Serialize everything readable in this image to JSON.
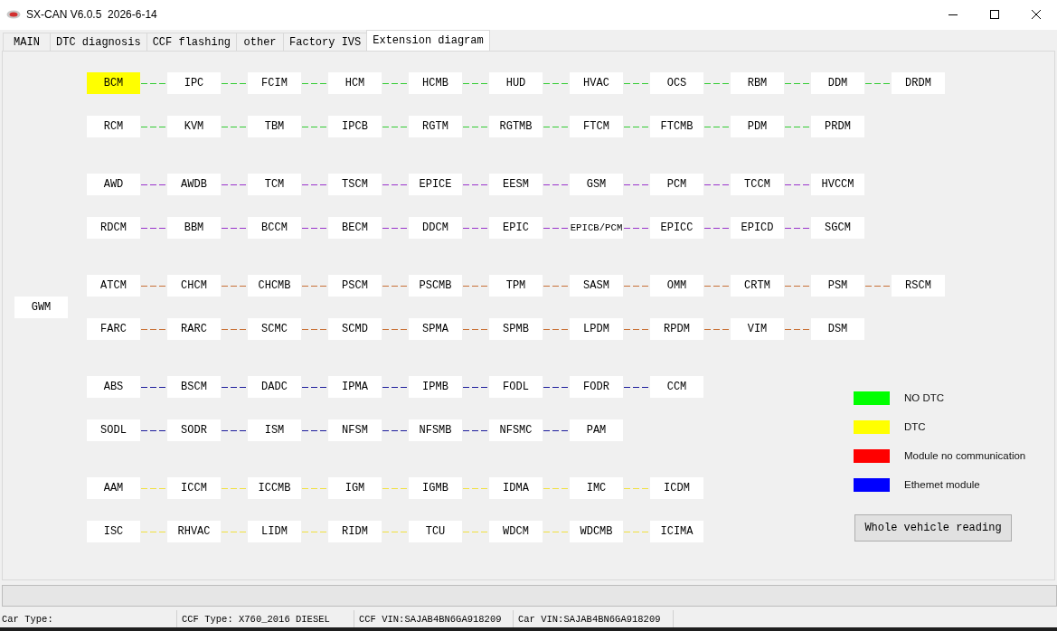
{
  "window": {
    "title": "SX-CAN V6.0.5  2026-6-14"
  },
  "tabs": [
    {
      "label": "MAIN",
      "selected": false
    },
    {
      "label": "DTC diagnosis",
      "selected": false
    },
    {
      "label": "CCF flashing",
      "selected": false
    },
    {
      "label": "other",
      "selected": false
    },
    {
      "label": "Factory IVS",
      "selected": false
    },
    {
      "label": "Extension diagram",
      "selected": true
    }
  ],
  "gateway": {
    "label": "GWM",
    "dtc": false
  },
  "groups": [
    {
      "color": "#33cc33",
      "rows": [
        [
          {
            "label": "BCM",
            "dtc": true
          },
          {
            "label": "IPC",
            "dtc": false
          },
          {
            "label": "FCIM",
            "dtc": false
          },
          {
            "label": "HCM",
            "dtc": false
          },
          {
            "label": "HCMB",
            "dtc": false
          },
          {
            "label": "HUD",
            "dtc": false
          },
          {
            "label": "HVAC",
            "dtc": false
          },
          {
            "label": "OCS",
            "dtc": false
          },
          {
            "label": "RBM",
            "dtc": false
          },
          {
            "label": "DDM",
            "dtc": false
          },
          {
            "label": "DRDM",
            "dtc": false
          }
        ],
        [
          {
            "label": "RCM",
            "dtc": false
          },
          {
            "label": "KVM",
            "dtc": false
          },
          {
            "label": "TBM",
            "dtc": false
          },
          {
            "label": "IPCB",
            "dtc": false
          },
          {
            "label": "RGTM",
            "dtc": false
          },
          {
            "label": "RGTMB",
            "dtc": false
          },
          {
            "label": "FTCM",
            "dtc": false
          },
          {
            "label": "FTCMB",
            "dtc": false
          },
          {
            "label": "PDM",
            "dtc": false
          },
          {
            "label": "PRDM",
            "dtc": false
          }
        ]
      ]
    },
    {
      "color": "#9933cc",
      "rows": [
        [
          {
            "label": "AWD",
            "dtc": false
          },
          {
            "label": "AWDB",
            "dtc": false
          },
          {
            "label": "TCM",
            "dtc": false
          },
          {
            "label": "TSCM",
            "dtc": false
          },
          {
            "label": "EPICE",
            "dtc": false
          },
          {
            "label": "EESM",
            "dtc": false
          },
          {
            "label": "GSM",
            "dtc": false
          },
          {
            "label": "PCM",
            "dtc": false
          },
          {
            "label": "TCCM",
            "dtc": false
          },
          {
            "label": "HVCCM",
            "dtc": false
          }
        ],
        [
          {
            "label": "RDCM",
            "dtc": false
          },
          {
            "label": "BBM",
            "dtc": false
          },
          {
            "label": "BCCM",
            "dtc": false
          },
          {
            "label": "BECM",
            "dtc": false
          },
          {
            "label": "DDCM",
            "dtc": false
          },
          {
            "label": "EPIC",
            "dtc": false
          },
          {
            "label": "EPICB/PCM",
            "dtc": false
          },
          {
            "label": "EPICC",
            "dtc": false
          },
          {
            "label": "EPICD",
            "dtc": false
          },
          {
            "label": "SGCM",
            "dtc": false
          }
        ]
      ]
    },
    {
      "color": "#c87137",
      "rows": [
        [
          {
            "label": "ATCM",
            "dtc": false
          },
          {
            "label": "CHCM",
            "dtc": false
          },
          {
            "label": "CHCMB",
            "dtc": false
          },
          {
            "label": "PSCM",
            "dtc": false
          },
          {
            "label": "PSCMB",
            "dtc": false
          },
          {
            "label": "TPM",
            "dtc": false
          },
          {
            "label": "SASM",
            "dtc": false
          },
          {
            "label": "OMM",
            "dtc": false
          },
          {
            "label": "CRTM",
            "dtc": false
          },
          {
            "label": "PSM",
            "dtc": false
          },
          {
            "label": "RSCM",
            "dtc": false
          }
        ],
        [
          {
            "label": "FARC",
            "dtc": false
          },
          {
            "label": "RARC",
            "dtc": false
          },
          {
            "label": "SCMC",
            "dtc": false
          },
          {
            "label": "SCMD",
            "dtc": false
          },
          {
            "label": "SPMA",
            "dtc": false
          },
          {
            "label": "SPMB",
            "dtc": false
          },
          {
            "label": "LPDM",
            "dtc": false
          },
          {
            "label": "RPDM",
            "dtc": false
          },
          {
            "label": "VIM",
            "dtc": false
          },
          {
            "label": "DSM",
            "dtc": false
          }
        ]
      ]
    },
    {
      "color": "#1c1c9c",
      "rows": [
        [
          {
            "label": "ABS",
            "dtc": false
          },
          {
            "label": "BSCM",
            "dtc": false
          },
          {
            "label": "DADC",
            "dtc": false
          },
          {
            "label": "IPMA",
            "dtc": false
          },
          {
            "label": "IPMB",
            "dtc": false
          },
          {
            "label": "FODL",
            "dtc": false
          },
          {
            "label": "FODR",
            "dtc": false
          },
          {
            "label": "CCM",
            "dtc": false
          }
        ],
        [
          {
            "label": "SODL",
            "dtc": false
          },
          {
            "label": "SODR",
            "dtc": false
          },
          {
            "label": "ISM",
            "dtc": false
          },
          {
            "label": "NFSM",
            "dtc": false
          },
          {
            "label": "NFSMB",
            "dtc": false
          },
          {
            "label": "NFSMC",
            "dtc": false
          },
          {
            "label": "PAM",
            "dtc": false
          }
        ]
      ]
    },
    {
      "color": "#f0e040",
      "rows": [
        [
          {
            "label": "AAM",
            "dtc": false
          },
          {
            "label": "ICCM",
            "dtc": false
          },
          {
            "label": "ICCMB",
            "dtc": false
          },
          {
            "label": "IGM",
            "dtc": false
          },
          {
            "label": "IGMB",
            "dtc": false
          },
          {
            "label": "IDMA",
            "dtc": false
          },
          {
            "label": "IMC",
            "dtc": false
          },
          {
            "label": "ICDM",
            "dtc": false
          }
        ],
        [
          {
            "label": "ISC",
            "dtc": false
          },
          {
            "label": "RHVAC",
            "dtc": false
          },
          {
            "label": "LIDM",
            "dtc": false
          },
          {
            "label": "RIDM",
            "dtc": false
          },
          {
            "label": "TCU",
            "dtc": false
          },
          {
            "label": "WDCM",
            "dtc": false
          },
          {
            "label": "WDCMB",
            "dtc": false
          },
          {
            "label": "ICIMA",
            "dtc": false
          }
        ]
      ]
    }
  ],
  "legend": [
    {
      "label": "NO DTC",
      "color": "#00ff00"
    },
    {
      "label": "DTC",
      "color": "#ffff00"
    },
    {
      "label": "Module no communication",
      "color": "#ff0000"
    },
    {
      "label": "Ethemet module",
      "color": "#0000ff"
    }
  ],
  "reading_button": {
    "label": "Whole vehicle reading"
  },
  "progress": {
    "level": 0
  },
  "status_bar": [
    {
      "text": "Car Type:"
    },
    {
      "text": "CCF Type: X760_2016 DIESEL"
    },
    {
      "text": "CCF VIN:SAJAB4BN6GA918209"
    },
    {
      "text": "Car VIN:SAJAB4BN6GA918209"
    }
  ]
}
